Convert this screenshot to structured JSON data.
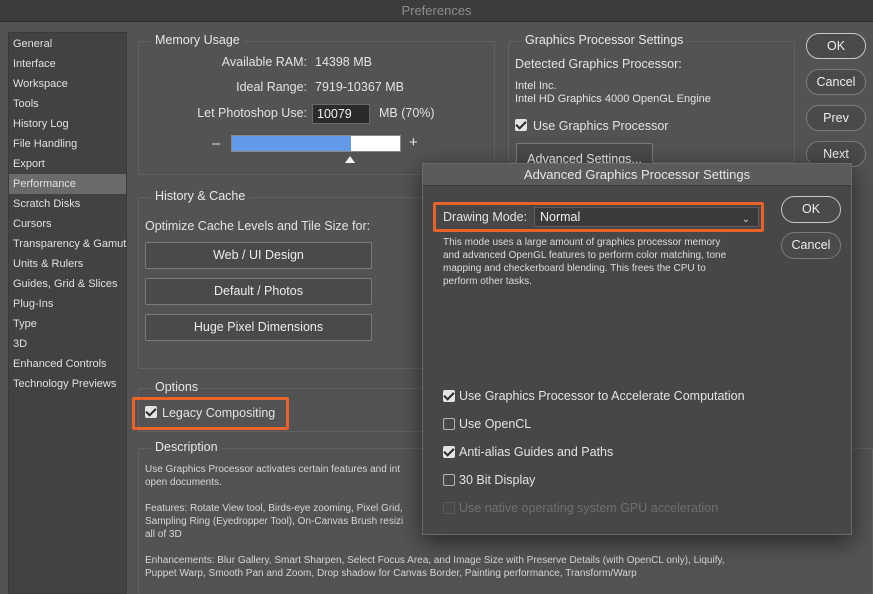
{
  "window": {
    "title": "Preferences"
  },
  "sidebar": {
    "items": [
      {
        "label": "General"
      },
      {
        "label": "Interface"
      },
      {
        "label": "Workspace"
      },
      {
        "label": "Tools"
      },
      {
        "label": "History Log"
      },
      {
        "label": "File Handling"
      },
      {
        "label": "Export"
      },
      {
        "label": "Performance"
      },
      {
        "label": "Scratch Disks"
      },
      {
        "label": "Cursors"
      },
      {
        "label": "Transparency & Gamut"
      },
      {
        "label": "Units & Rulers"
      },
      {
        "label": "Guides, Grid & Slices"
      },
      {
        "label": "Plug-Ins"
      },
      {
        "label": "Type"
      },
      {
        "label": "3D"
      },
      {
        "label": "Enhanced Controls"
      },
      {
        "label": "Technology Previews"
      }
    ],
    "active": "Performance"
  },
  "memory": {
    "title": "Memory Usage",
    "available_label": "Available RAM:",
    "available_value": "14398 MB",
    "ideal_label": "Ideal Range:",
    "ideal_value": "7919-10367 MB",
    "let_label": "Let Photoshop Use:",
    "let_value": "10079",
    "let_unit": "MB (70%)",
    "minus": "–",
    "plus": "+",
    "slider_fraction": 0.7
  },
  "history": {
    "title": "History & Cache",
    "subtitle": "Optimize Cache Levels and Tile Size for:",
    "buttons": [
      "Web / UI Design",
      "Default / Photos",
      "Huge Pixel Dimensions"
    ]
  },
  "options": {
    "title": "Options",
    "legacy_label": "Legacy Compositing",
    "legacy_checked": true
  },
  "description": {
    "title": "Description",
    "text": "Use Graphics Processor activates certain features and int\nopen documents.\n\nFeatures: Rotate View tool, Birds-eye zooming, Pixel Grid,\nSampling Ring (Eyedropper Tool), On-Canvas Brush resizi\nall of 3D\n\nEnhancements: Blur Gallery, Smart Sharpen, Select Focus Area, and Image Size with Preserve Details (with OpenCL only), Liquify,\nPuppet Warp, Smooth Pan and Zoom, Drop shadow for Canvas Border, Painting performance, Transform/Warp"
  },
  "gpu": {
    "title": "Graphics Processor Settings",
    "detected_label": "Detected Graphics Processor:",
    "vendor": "Intel Inc.",
    "model": "Intel HD Graphics 4000 OpenGL Engine",
    "use_label": "Use Graphics Processor",
    "use_checked": true,
    "advanced_button": "Advanced Settings..."
  },
  "actions": {
    "ok": "OK",
    "cancel": "Cancel",
    "prev": "Prev",
    "next": "Next"
  },
  "dialog": {
    "title": "Advanced Graphics Processor Settings",
    "drawing_mode_label": "Drawing Mode:",
    "drawing_mode_value": "Normal",
    "mode_description": "This mode uses a large amount of graphics processor memory\nand advanced OpenGL features to perform color matching, tone\nmapping and checkerboard blending.  This frees the CPU to\nperform other tasks.",
    "ok": "OK",
    "cancel": "Cancel",
    "checkboxes": [
      {
        "label": "Use Graphics Processor to Accelerate Computation",
        "checked": true,
        "enabled": true
      },
      {
        "label": "Use OpenCL",
        "checked": false,
        "enabled": true
      },
      {
        "label": "Anti-alias Guides and Paths",
        "checked": true,
        "enabled": true
      },
      {
        "label": "30 Bit Display",
        "checked": false,
        "enabled": true
      },
      {
        "label": "Use native operating system GPU acceleration",
        "checked": false,
        "enabled": false
      }
    ]
  },
  "colors": {
    "highlight": "#e8632a",
    "slider_fill": "#6499e8"
  }
}
